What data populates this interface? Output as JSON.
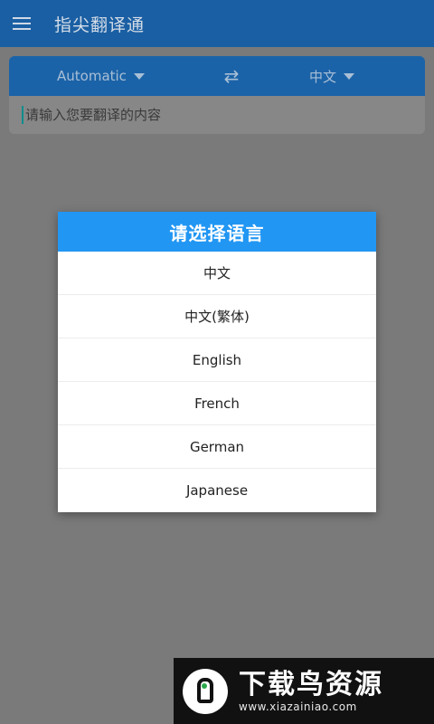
{
  "app": {
    "title": "指尖翻译通"
  },
  "languageBar": {
    "source": "Automatic",
    "target": "中文",
    "swapGlyph": "⇄"
  },
  "input": {
    "placeholder": "请输入您要翻译的内容"
  },
  "dialog": {
    "title": "请选择语言",
    "options": [
      "中文",
      "中文(繁体)",
      "English",
      "French",
      "German",
      "Japanese"
    ]
  },
  "watermark": {
    "name": "下载鸟资源",
    "url": "www.xiazainiao.com"
  },
  "colors": {
    "appbar": "#1a5fa3",
    "dialogHeader": "#2196f3",
    "overlay": "#7a7a7a"
  }
}
